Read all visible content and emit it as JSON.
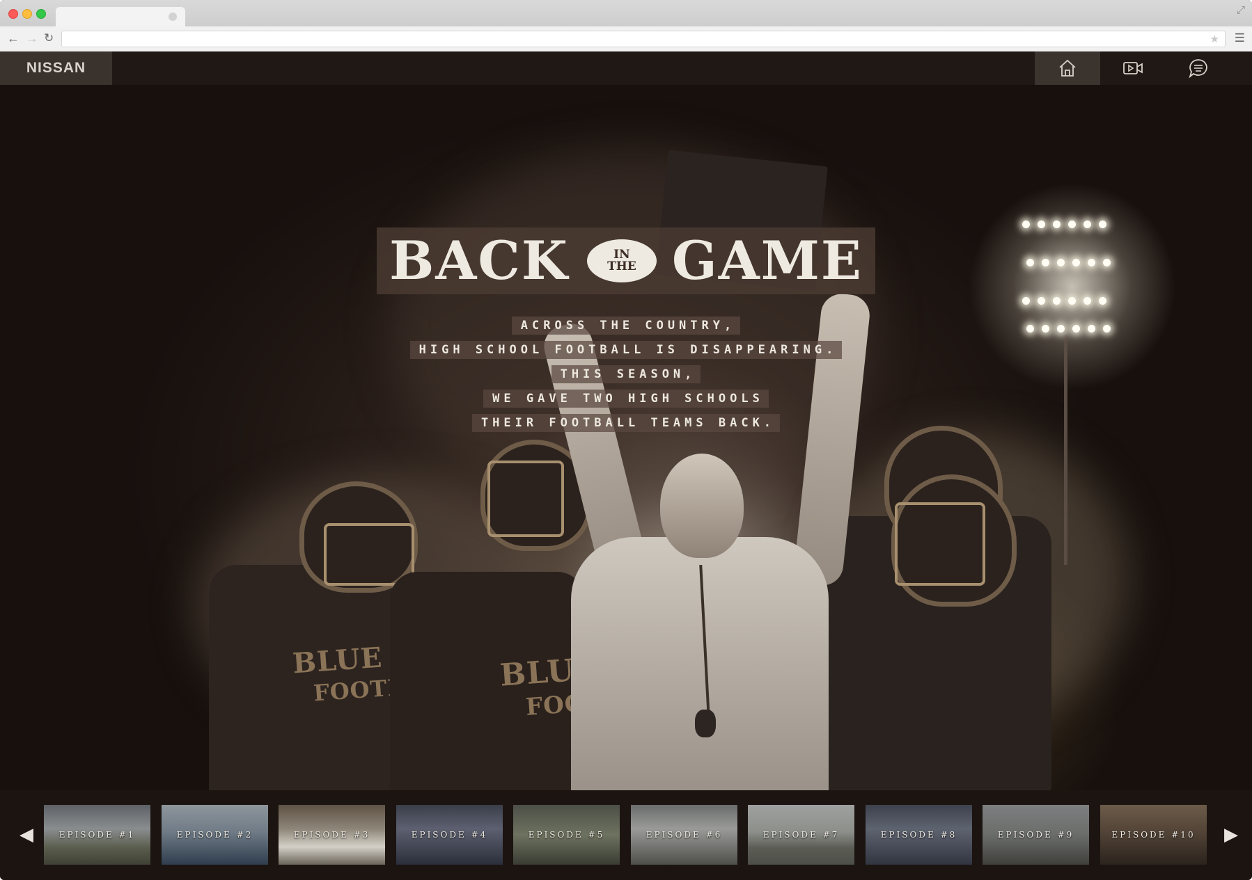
{
  "browser": {
    "address_value": "",
    "icons": [
      "back-arrow-icon",
      "forward-arrow-icon",
      "reload-icon",
      "star-icon",
      "menu-icon",
      "fullscreen-icon"
    ]
  },
  "site": {
    "logo_text": "NISSAN",
    "nav": [
      {
        "icon": "home-icon",
        "active": true
      },
      {
        "icon": "video-icon",
        "active": false
      },
      {
        "icon": "chat-icon",
        "active": false
      }
    ]
  },
  "hero": {
    "title_left": "BACK",
    "title_badge_top": "IN",
    "title_badge_bottom": "THE",
    "title_right": "GAME",
    "tagline": [
      "ACROSS THE COUNTRY,",
      "HIGH SCHOOL FOOTBALL IS DISAPPEARING.",
      "THIS SEASON,",
      "WE GAVE TWO HIGH SCHOOLS",
      "THEIR FOOTBALL TEAMS BACK."
    ],
    "jersey_left": "BLUE DEV",
    "jersey_left_2": "FOOTBA",
    "jersey_center": "BLU",
    "jersey_center_2": "FOO"
  },
  "episodes": [
    {
      "label": "EPISODE #1"
    },
    {
      "label": "EPISODE #2"
    },
    {
      "label": "EPISODE #3"
    },
    {
      "label": "EPISODE #4"
    },
    {
      "label": "EPISODE #5"
    },
    {
      "label": "EPISODE #6"
    },
    {
      "label": "EPISODE #7"
    },
    {
      "label": "EPISODE #8"
    },
    {
      "label": "EPISODE #9"
    },
    {
      "label": "EPISODE #10"
    }
  ],
  "colors": {
    "background": "#1c1411",
    "header": "#201814",
    "logo_block": "#3a322d",
    "title_text": "#eeeae2",
    "plate": "#4b3a32"
  }
}
